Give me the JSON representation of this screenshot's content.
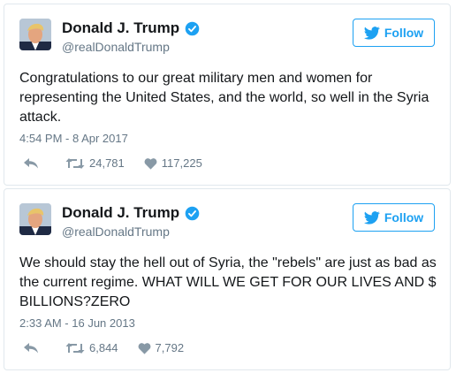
{
  "tweets": [
    {
      "display_name": "Donald J. Trump",
      "handle": "@realDonaldTrump",
      "follow_label": "Follow",
      "text": "Congratulations to our great military men and women for representing the United States, and the world, so well in the Syria attack.",
      "timestamp": "4:54 PM - 8 Apr 2017",
      "retweets": "24,781",
      "likes": "117,225"
    },
    {
      "display_name": "Donald J. Trump",
      "handle": "@realDonaldTrump",
      "follow_label": "Follow",
      "text": "We should stay the hell out of Syria, the \"rebels\" are just as bad as the current regime. WHAT WILL WE GET FOR OUR LIVES AND $ BILLIONS?ZERO",
      "timestamp": "2:33 AM - 16 Jun 2013",
      "retweets": "6,844",
      "likes": "7,792"
    }
  ],
  "icons": {
    "verified": "verified-badge-icon",
    "bird": "twitter-bird-icon",
    "reply": "reply-icon",
    "retweet": "retweet-icon",
    "like": "heart-icon"
  },
  "colors": {
    "accent": "#1da1f2",
    "text": "#14171a",
    "muted": "#657786",
    "border": "#e1e8ed"
  }
}
